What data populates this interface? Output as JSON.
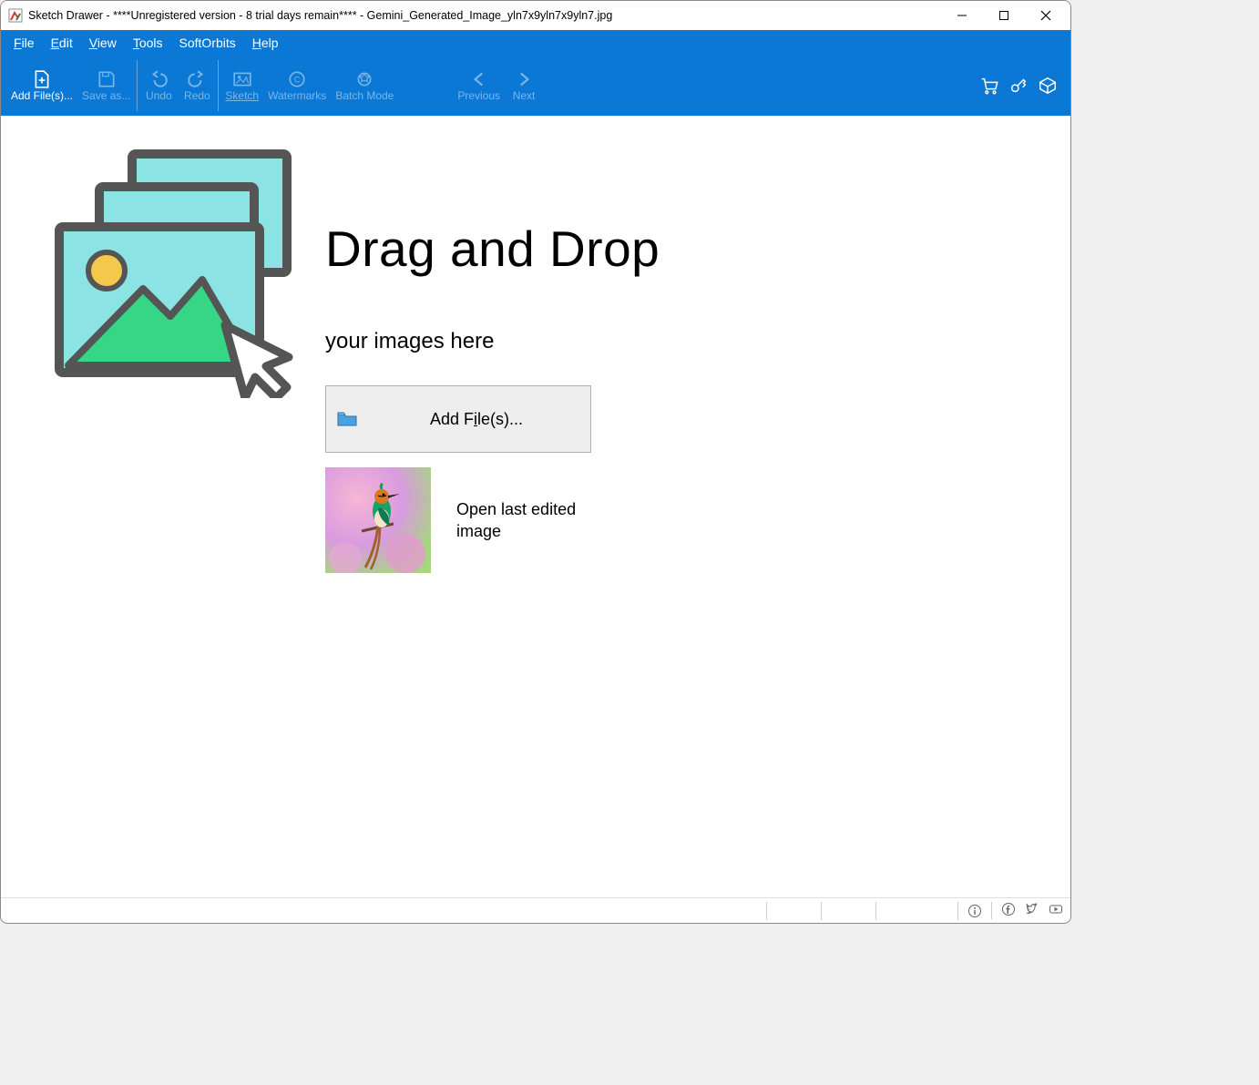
{
  "window": {
    "title": "Sketch Drawer - ****Unregistered version - 8 trial days remain**** - Gemini_Generated_Image_yln7x9yln7x9yln7.jpg"
  },
  "menu": {
    "file": "File",
    "edit": "Edit",
    "view": "View",
    "tools": "Tools",
    "softorbits": "SoftOrbits",
    "help": "Help"
  },
  "toolbar": {
    "addfiles": "Add File(s)...",
    "saveas": "Save as...",
    "undo": "Undo",
    "redo": "Redo",
    "sketch": "Sketch",
    "watermarks": "Watermarks",
    "batchmode": "Batch Mode",
    "previous": "Previous",
    "next": "Next"
  },
  "main": {
    "h1": "Drag and Drop",
    "h2": "your images here",
    "addfiles_btn": "Add File(s)...",
    "open_last": "Open last edited image"
  }
}
